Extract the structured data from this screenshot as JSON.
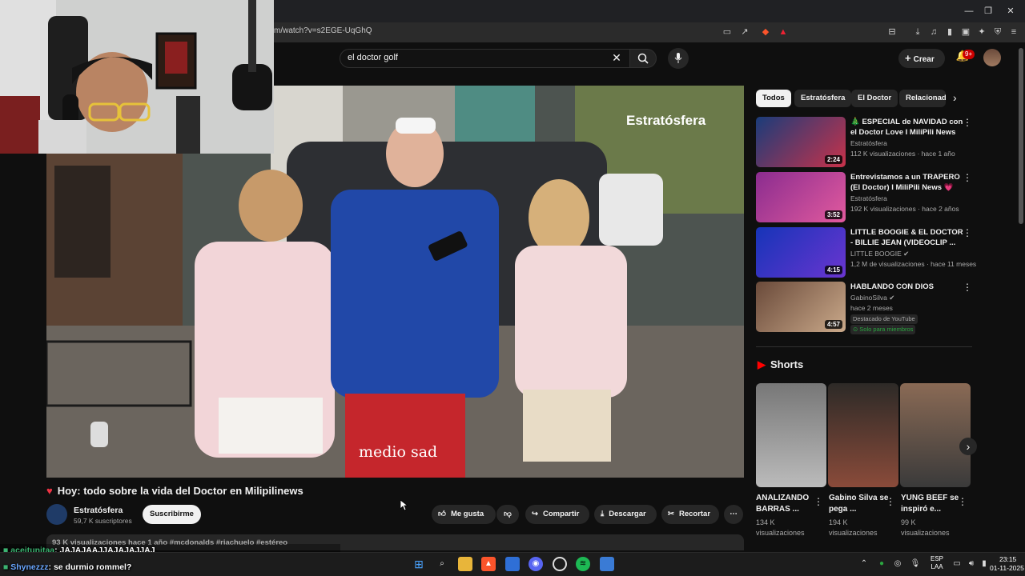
{
  "browser": {
    "url_fragment": "m/watch?v=s2EGE-UqGhQ"
  },
  "header": {
    "search_value": "el doctor golf",
    "create_label": "Crear",
    "notifications_badge": "9+"
  },
  "video": {
    "watermark": "Estratósfera",
    "caption": "medio sad",
    "title": "Hoy: todo sobre la vida del Doctor en Milipilinews",
    "channel_name": "Estratósfera",
    "channel_subs": "59,7 K suscriptores",
    "subscribe_label": "Suscribirme",
    "actions": {
      "like": "Me gusta",
      "share": "Compartir",
      "download": "Descargar",
      "clip": "Recortar"
    },
    "description_preview": "93 K visualizaciones  hace 1 año  #mcdonalds #riachuelo #estéreo"
  },
  "chips": [
    "Todos",
    "Estratósfera",
    "El Doctor",
    "Relacionad"
  ],
  "related": [
    {
      "title": "🎄 ESPECIAL de NAVIDAD con el Doctor Love I MiliPili News",
      "channel": "Estratósfera",
      "meta": "112 K visualizaciones · hace 1 año",
      "duration": "2:24"
    },
    {
      "title": "Entrevistamos a un TRAPERO (El Doctor) I MiliPili News 💗",
      "channel": "Estratósfera",
      "meta": "192 K visualizaciones · hace 2 años",
      "duration": "3:52"
    },
    {
      "title": "LITTLE BOOGIE & EL DOCTOR - BILLIE JEAN (VIDEOCLIP ...",
      "channel": "LITTLE BOOGIE ✔",
      "meta": "1,2 M de visualizaciones · hace 11 meses",
      "duration": "4:15"
    },
    {
      "title": "HABLANDO CON DIOS",
      "channel": "GabinoSilva ✔",
      "meta": "hace 2 meses",
      "duration": "4:57",
      "badge1": "Destacado de YouTube",
      "badge2": "Solo para miembros"
    }
  ],
  "shorts": {
    "header": "Shorts",
    "items": [
      {
        "title": "ANALIZANDO BARRAS ...",
        "views": "134 K visualizaciones"
      },
      {
        "title": "Gabino Silva se pega ...",
        "views": "194 K visualizaciones"
      },
      {
        "title": "YUNG BEEF se inspiró e...",
        "views": "99 K visualizaciones"
      }
    ]
  },
  "chat": [
    {
      "user": "aceitunitaa",
      "text": ": JAJAJAAJJAJAJAJJAJ"
    },
    {
      "user": "Shynezzz",
      "text": ": se durmio rommel?"
    }
  ],
  "taskbar": {
    "lang_1": "ESP",
    "lang_2": "LAA",
    "time": "23:15",
    "date": "01-11-2025"
  },
  "colors": {
    "bg": "#0f0f0f",
    "chip": "#272727",
    "accent_red": "#ff0000",
    "subscribe_bg": "#f1f1f1"
  }
}
